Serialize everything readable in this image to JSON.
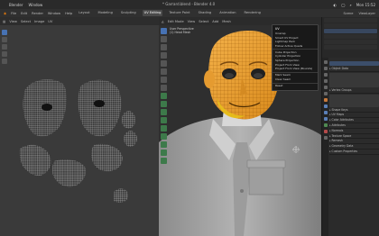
{
  "menubar": {
    "app": "Blender",
    "window_menu": "Window",
    "title": "* Garrard.blend - Blender 4.0",
    "status_items": [
      "◐",
      "◯",
      "⌕",
      "Mon 15:52"
    ]
  },
  "topbar": {
    "menus": [
      "File",
      "Edit",
      "Render",
      "Window",
      "Help"
    ],
    "workspaces": [
      "Layout",
      "Modeling",
      "Sculpting",
      "UV Editing",
      "Texture Paint",
      "Shading",
      "Animation",
      "Rendering"
    ],
    "active_workspace": "UV Editing",
    "scene": "Scene",
    "view_layer": "ViewLayer"
  },
  "uv_editor": {
    "header_items": [
      "View",
      "Select",
      "Image",
      "UV"
    ]
  },
  "viewport": {
    "header_items": [
      "Edit Mode",
      "View",
      "Select",
      "Add",
      "Mesh"
    ],
    "mode_info": "User Perspective",
    "mode_info2": "(1) Head Mesh"
  },
  "uv_menu": {
    "title": "UV",
    "items": [
      "Unwrap",
      "Smart UV Project",
      "Lightmap Pack",
      "Follow Active Quads",
      "Cube Projection",
      "Cylinder Projection",
      "Sphere Projection",
      "Project From View",
      "Project From View (Bounds)",
      "Mark Seam",
      "Clear Seam",
      "Reset"
    ]
  },
  "properties": {
    "sections": [
      "Object Data",
      "Vertex Groups",
      "Shape Keys",
      "UV Maps",
      "Color Attributes",
      "Attributes",
      "Normals",
      "Texture Space",
      "Remesh",
      "Geometry Data",
      "Custom Properties"
    ]
  }
}
